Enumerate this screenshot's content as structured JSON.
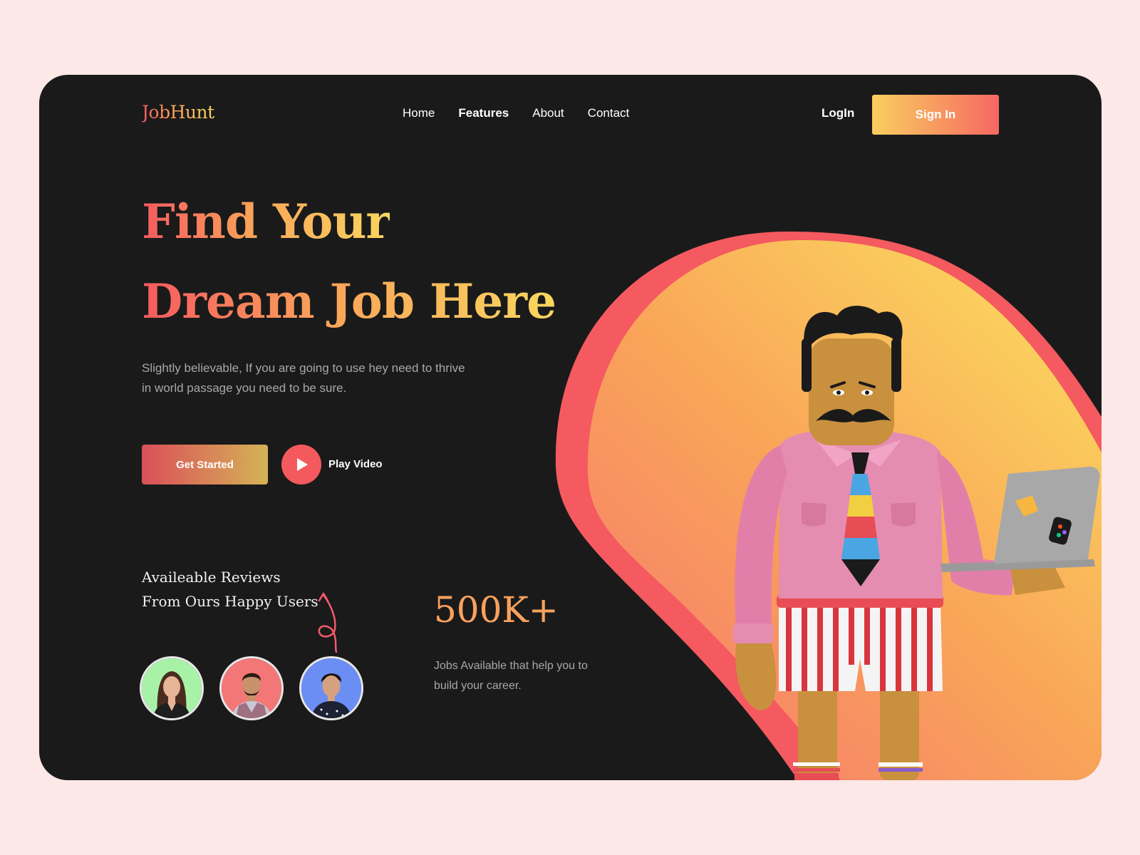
{
  "brand": {
    "logo": "JobHunt"
  },
  "nav": {
    "items": [
      {
        "label": "Home",
        "active": false
      },
      {
        "label": "Features",
        "active": true
      },
      {
        "label": "About",
        "active": false
      },
      {
        "label": "Contact",
        "active": false
      }
    ],
    "login_label": "LogIn",
    "signin_label": "Sign In"
  },
  "hero": {
    "title_line1": "Find Your",
    "title_line2": "Dream Job Here",
    "subtitle": "Slightly believable, If you are going to use hey need to thrive in world passage you need to be sure.",
    "cta_label": "Get Started",
    "video_label": "Play Video"
  },
  "reviews": {
    "title_line1": "Availeable Reviews",
    "title_line2": "From Ours Happy Users",
    "avatars": [
      {
        "name": "avatar-woman",
        "bg": "#a8f2a8"
      },
      {
        "name": "avatar-man",
        "bg": "#f37777"
      },
      {
        "name": "avatar-person",
        "bg": "#6b8ef5"
      }
    ]
  },
  "stats": {
    "value": "500K+",
    "description": "Jobs Available that help you to build your career."
  },
  "colors": {
    "background": "#fde8e8",
    "card": "#1a1a1a",
    "accent_red": "#f65a5f",
    "accent_yellow": "#f9d75f"
  }
}
